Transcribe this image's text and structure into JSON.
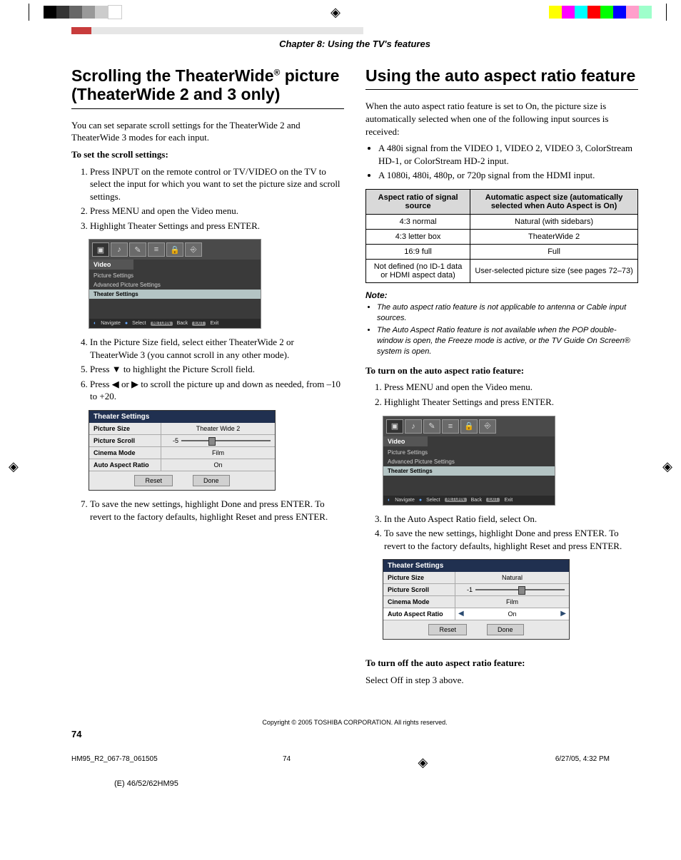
{
  "header": {
    "chapter": "Chapter 8: Using the TV's features"
  },
  "left": {
    "title_pre": "Scrolling the TheaterWide",
    "title_sup": "®",
    "title_post": " picture (TheaterWide 2 and 3 only)",
    "intro": "You can set separate scroll settings for the TheaterWide 2 and TheaterWide 3 modes for each input.",
    "subhead": "To set the scroll settings:",
    "steps": [
      "Press INPUT on the remote control or TV/VIDEO on the TV to select the input for which you want to set the picture size and scroll settings.",
      "Press MENU and open the Video menu.",
      "Highlight Theater Settings and press ENTER.",
      "In the Picture Size field, select either TheaterWide 2 or TheaterWide 3 (you cannot scroll in any other mode).",
      "Press ▼ to highlight the Picture Scroll field.",
      "Press ◀ or ▶ to scroll the picture up and down as needed, from –10 to +20.",
      "To save the new settings, highlight Done and press ENTER. To revert to the factory defaults, highlight Reset and press ENTER."
    ],
    "osd1": {
      "tab": "Video",
      "items": [
        "Picture Settings",
        "Advanced Picture Settings",
        "Theater Settings"
      ],
      "highlight": 2,
      "nav": [
        "Navigate",
        "Select",
        "Back",
        "Exit"
      ],
      "nav_keys": [
        "",
        "",
        "RETURN",
        "EXIT"
      ]
    },
    "ts1": {
      "title": "Theater Settings",
      "rows": [
        {
          "label": "Picture Size",
          "value": "Theater Wide 2"
        },
        {
          "label": "Picture Scroll",
          "value": "-5",
          "slider": true,
          "pos": 30
        },
        {
          "label": "Cinema Mode",
          "value": "Film"
        },
        {
          "label": "Auto Aspect Ratio",
          "value": "On"
        }
      ],
      "buttons": [
        "Reset",
        "Done"
      ]
    }
  },
  "right": {
    "title": "Using the auto aspect ratio feature",
    "intro": "When the auto aspect ratio feature is set to On, the picture size is automatically selected when one of the following input sources is received:",
    "bullets": [
      "A 480i signal from the VIDEO 1, VIDEO 2, VIDEO 3, ColorStream HD-1, or ColorStream HD-2 input.",
      "A 1080i, 480i, 480p, or 720p signal from the HDMI input."
    ],
    "table": {
      "h1": "Aspect ratio of signal source",
      "h2": "Automatic aspect size (automatically selected when Auto Aspect is On)",
      "rows": [
        [
          "4:3 normal",
          "Natural (with sidebars)"
        ],
        [
          "4:3 letter box",
          "TheaterWide 2"
        ],
        [
          "16:9 full",
          "Full"
        ],
        [
          "Not defined (no ID-1 data or HDMI aspect data)",
          "User-selected picture size (see pages 72–73)"
        ]
      ]
    },
    "note_label": "Note:",
    "notes": [
      "The auto aspect ratio feature is not applicable to antenna or Cable input sources.",
      "The Auto Aspect Ratio feature is not available when the POP double-window is open, the Freeze mode is active, or the TV Guide On Screen® system is open."
    ],
    "on_head": "To turn on the auto aspect ratio feature:",
    "on_steps": [
      "Press MENU and open the Video menu.",
      "Highlight Theater Settings and press ENTER.",
      "In the Auto Aspect Ratio field, select On.",
      "To save the new settings, highlight Done and press ENTER. To revert to the factory defaults, highlight Reset and press ENTER."
    ],
    "osd2": {
      "tab": "Video",
      "items": [
        "Picture Settings",
        "Advanced Picture Settings",
        "Theater Settings"
      ],
      "highlight": 2,
      "nav": [
        "Navigate",
        "Select",
        "Back",
        "Exit"
      ],
      "nav_keys": [
        "",
        "",
        "RETURN",
        "EXIT"
      ]
    },
    "ts2": {
      "title": "Theater Settings",
      "rows": [
        {
          "label": "Picture Size",
          "value": "Natural"
        },
        {
          "label": "Picture Scroll",
          "value": "-1",
          "slider": true,
          "pos": 48
        },
        {
          "label": "Cinema Mode",
          "value": "Film"
        },
        {
          "label": "Auto Aspect Ratio",
          "value": "On",
          "arrows": true,
          "selected": true
        }
      ],
      "buttons": [
        "Reset",
        "Done"
      ]
    },
    "off_head": "To turn off the auto aspect ratio feature:",
    "off_text": "Select Off in step 3 above."
  },
  "footer": {
    "copyright": "Copyright © 2005 TOSHIBA CORPORATION. All rights reserved.",
    "page": "74",
    "file": "HM95_R2_067-78_061505",
    "pg2": "74",
    "date": "6/27/05, 4:32 PM",
    "model": "(E) 46/52/62HM95"
  },
  "colorbar": [
    "#000",
    "#333",
    "#666",
    "#999",
    "#ccc",
    "#fff",
    "#ffff00",
    "#ff00ff",
    "#00ffff",
    "#ff0000",
    "#00ff00",
    "#0000ff",
    "#ff77c0",
    "#77ffc0"
  ]
}
